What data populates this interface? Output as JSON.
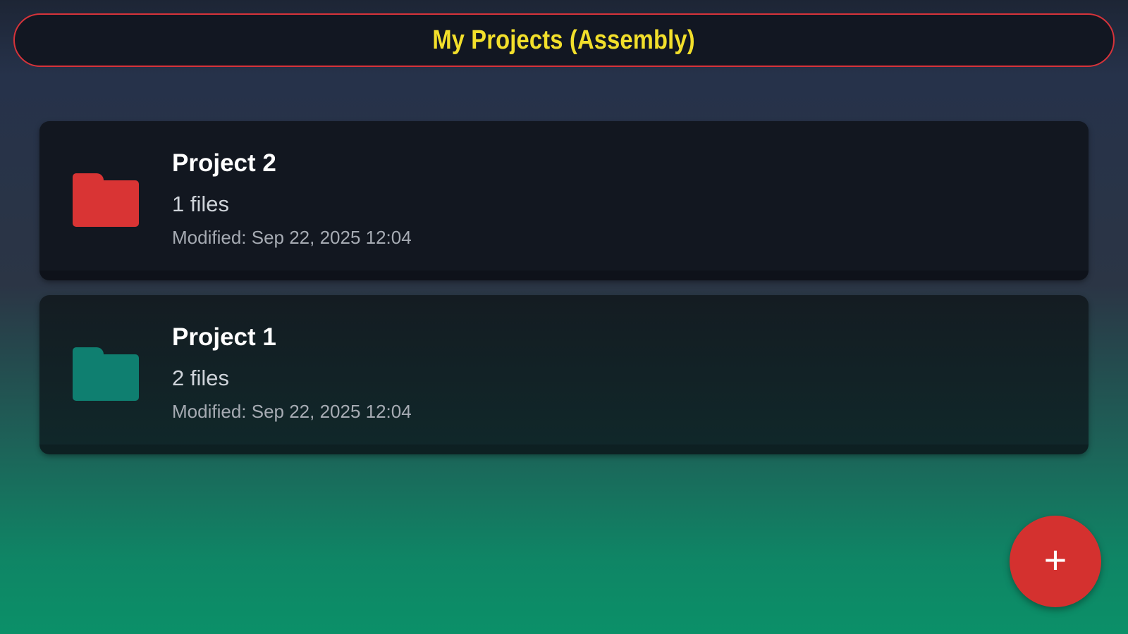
{
  "header": {
    "title": "My Projects (Assembly)"
  },
  "projects": [
    {
      "name": "Project 2",
      "files": "1 files",
      "modified": "Modified: Sep 22, 2025 12:04",
      "icon": "folder-icon",
      "folder_color": "#d93434"
    },
    {
      "name": "Project 1",
      "files": "2 files",
      "modified": "Modified: Sep 22, 2025 12:04",
      "icon": "folder-icon",
      "folder_color": "#0f7f70"
    }
  ],
  "fab": {
    "label": "+",
    "icon": "plus-icon",
    "color": "#d4312f"
  },
  "colors": {
    "title_text": "#f2df2b",
    "title_border": "#d7333a"
  }
}
